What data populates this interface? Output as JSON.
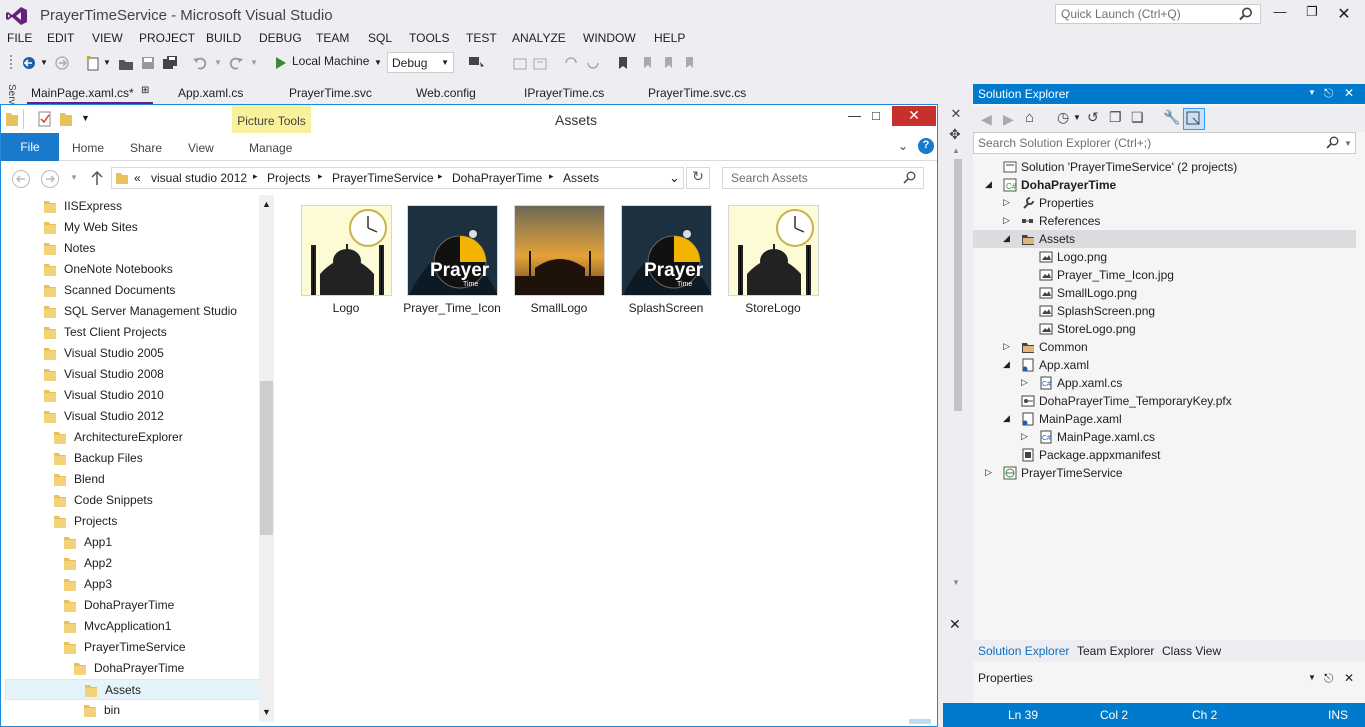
{
  "window": {
    "title": "PrayerTimeService - Microsoft Visual Studio",
    "quick_launch": "Quick Launch (Ctrl+Q)"
  },
  "menu": [
    "FILE",
    "EDIT",
    "VIEW",
    "PROJECT",
    "BUILD",
    "DEBUG",
    "TEAM",
    "SQL",
    "TOOLS",
    "TEST",
    "ANALYZE",
    "WINDOW",
    "HELP"
  ],
  "toolbar": {
    "run_target": "Local Machine",
    "configuration": "Debug"
  },
  "side_label": "Serv",
  "doc_tabs": [
    "MainPage.xaml.cs*",
    "App.xaml.cs",
    "PrayerTime.svc",
    "Web.config",
    "IPrayerTime.cs",
    "PrayerTime.svc.cs"
  ],
  "explorer": {
    "title": "Assets",
    "picture_tools": "Picture Tools",
    "ribbon_tabs": [
      "File",
      "Home",
      "Share",
      "View",
      "Manage"
    ],
    "breadcrumb": [
      "«",
      "visual studio 2012",
      "Projects",
      "PrayerTimeService",
      "DohaPrayerTime",
      "Assets"
    ],
    "search_placeholder": "Search Assets",
    "nav": [
      "IISExpress",
      "My Web Sites",
      "Notes",
      "OneNote Notebooks",
      "Scanned Documents",
      "SQL Server Management Studio",
      "Test Client Projects",
      "Visual Studio 2005",
      "Visual Studio 2008",
      "Visual Studio 2010",
      "Visual Studio 2012",
      "ArchitectureExplorer",
      "Backup Files",
      "Blend",
      "Code Snippets",
      "Projects",
      "App1",
      "App2",
      "App3",
      "DohaPrayerTime",
      "MvcApplication1",
      "PrayerTimeService",
      "DohaPrayerTime",
      "Assets",
      "bin"
    ],
    "nav_selected": "Assets",
    "files": [
      "Logo",
      "Prayer_Time_Icon",
      "SmallLogo",
      "SplashScreen",
      "StoreLogo"
    ],
    "thumb_text": "Prayer",
    "thumb_subtext": "Time"
  },
  "solution_explorer": {
    "title": "Solution Explorer",
    "search_placeholder": "Search Solution Explorer (Ctrl+;)",
    "tree": [
      "Solution 'PrayerTimeService' (2 projects)",
      "DohaPrayerTime",
      "Properties",
      "References",
      "Assets",
      "Logo.png",
      "Prayer_Time_Icon.jpg",
      "SmallLogo.png",
      "SplashScreen.png",
      "StoreLogo.png",
      "Common",
      "App.xaml",
      "App.xaml.cs",
      "DohaPrayerTime_TemporaryKey.pfx",
      "MainPage.xaml",
      "MainPage.xaml.cs",
      "Package.appxmanifest",
      "PrayerTimeService"
    ],
    "bottom_tabs": [
      "Solution Explorer",
      "Team Explorer",
      "Class View"
    ]
  },
  "properties": {
    "title": "Properties"
  },
  "status": {
    "line": "Ln 39",
    "col": "Col 2",
    "ch": "Ch 2",
    "mode": "INS"
  },
  "colors": {
    "accent": "#007acc",
    "explorer_blue": "#1979ca",
    "picture_tools": "#f9f09a",
    "folder": "#e8c15a"
  }
}
